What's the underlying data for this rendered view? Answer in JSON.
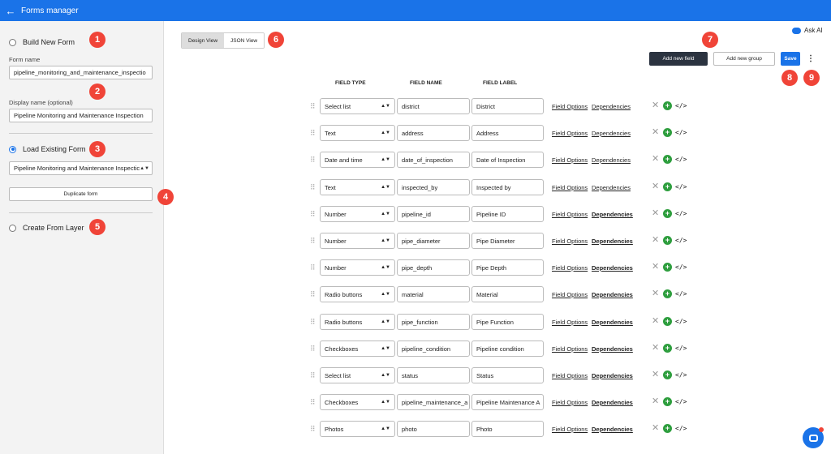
{
  "header": {
    "title": "Forms manager"
  },
  "sidebar": {
    "build_new": {
      "label": "Build New Form",
      "checked": false
    },
    "form_name": {
      "label": "Form name",
      "value": "pipeline_monitoring_and_maintenance_inspectio"
    },
    "display_name": {
      "label": "Display name (optional)",
      "value": "Pipeline Monitoring and Maintenance Inspection"
    },
    "load_existing": {
      "label": "Load Existing Form",
      "checked": true
    },
    "existing_select": {
      "value": "Pipeline Monitoring and Maintenance Inspectic"
    },
    "duplicate_button": "Duplicate form",
    "create_from_layer": {
      "label": "Create From Layer",
      "checked": false
    }
  },
  "toolbar": {
    "design_view": "Design View",
    "json_view": "JSON View",
    "ask_ai": "Ask AI",
    "add_field": "Add new field",
    "add_group": "Add new group",
    "save": "Save",
    "more": "⋮"
  },
  "columns": {
    "field_type": "FIELD TYPE",
    "field_name": "FIELD NAME",
    "field_label": "FIELD LABEL"
  },
  "links": {
    "field_options": "Field Options",
    "dependencies": "Dependencies"
  },
  "fields": [
    {
      "type": "Select list",
      "name": "district",
      "label": "District",
      "dep_bold": false
    },
    {
      "type": "Text",
      "name": "address",
      "label": "Address",
      "dep_bold": false
    },
    {
      "type": "Date and time",
      "name": "date_of_inspection",
      "label": "Date of Inspection",
      "dep_bold": false
    },
    {
      "type": "Text",
      "name": "inspected_by",
      "label": "Inspected by",
      "dep_bold": false
    },
    {
      "type": "Number",
      "name": "pipeline_id",
      "label": "Pipeline ID",
      "dep_bold": true
    },
    {
      "type": "Number",
      "name": "pipe_diameter",
      "label": "Pipe Diameter",
      "dep_bold": true
    },
    {
      "type": "Number",
      "name": "pipe_depth",
      "label": "Pipe Depth",
      "dep_bold": true
    },
    {
      "type": "Radio buttons",
      "name": "material",
      "label": "Material",
      "dep_bold": true
    },
    {
      "type": "Radio buttons",
      "name": "pipe_function",
      "label": "Pipe Function",
      "dep_bold": true
    },
    {
      "type": "Checkboxes",
      "name": "pipeline_condition",
      "label": "Pipeline condition",
      "dep_bold": true
    },
    {
      "type": "Select list",
      "name": "status",
      "label": "Status",
      "dep_bold": true
    },
    {
      "type": "Checkboxes",
      "name": "pipeline_maintenance_a",
      "label": "Pipeline Maintenance A",
      "dep_bold": true
    },
    {
      "type": "Photos",
      "name": "photo",
      "label": "Photo",
      "dep_bold": true
    }
  ],
  "callouts": [
    "1",
    "2",
    "3",
    "4",
    "5",
    "6",
    "7",
    "8",
    "9"
  ],
  "colors": {
    "primary": "#1a73e8",
    "dark_button": "#2b3340",
    "badge": "#f04438",
    "add_icon": "#2e9e3e"
  }
}
